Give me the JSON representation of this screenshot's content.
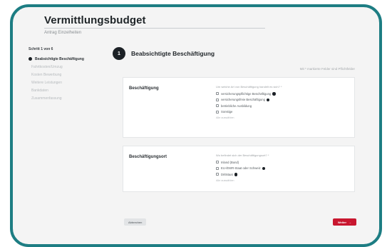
{
  "page": {
    "title": "Vermittlungsbudget",
    "subtitle": "Antrag Einzelheiten"
  },
  "sidebar": {
    "step_count": "Schritt 1 von 6",
    "items": [
      {
        "label": "Beabsichtigte Beschäftigung"
      },
      {
        "label": "Fahrtkosten/Umzug"
      },
      {
        "label": "Kosten Bewerbung"
      },
      {
        "label": "Weitere Leistungen"
      },
      {
        "label": "Bankdaten"
      },
      {
        "label": "Zusammenfassung"
      }
    ]
  },
  "step": {
    "number": "1",
    "title": "Beabsichtigte Beschäftigung",
    "required_note": "Mit * markierte Felder sind Pflichtfelder"
  },
  "sections": [
    {
      "label": "Beschäftigung",
      "question": "Um welche Art von Beschäftigung handelt es sich? *",
      "options": [
        {
          "label": "versicherungspflichtige Beschäftigung",
          "info": true
        },
        {
          "label": "versicherungsfreie Beschäftigung",
          "info": true
        },
        {
          "label": "betriebliche Ausbildung",
          "info": false
        },
        {
          "label": "Sonstige",
          "info": false
        }
      ],
      "select_all": "Alle auswählen"
    },
    {
      "label": "Beschäftigungsort",
      "question": "Wo befindet sich der Beschäftigungsort? *",
      "options": [
        {
          "label": "Inland (Bund)",
          "info": false
        },
        {
          "label": "EU-/EWR-Staat oder Schweiz",
          "info": true
        },
        {
          "label": "Drittstaat",
          "info": true
        }
      ],
      "select_all": "Alle auswählen"
    }
  ],
  "actions": {
    "back_label": "Abbrechen",
    "next_label": "Weiter",
    "next_arrow": "→"
  }
}
